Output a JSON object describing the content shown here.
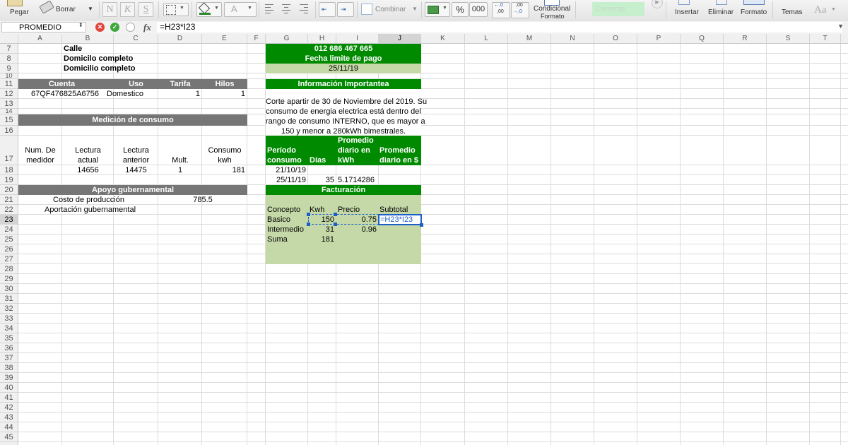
{
  "ribbon": {
    "paste_label": "Pegar",
    "clear_label": "Borrar",
    "bold": "N",
    "italic": "K",
    "underline": "S",
    "merge_label": "Combinar",
    "percent": "%",
    "thousands": "000",
    "inc_decimals_top": "←,0",
    "inc_decimals_bottom": ",00",
    "dec_decimals_top": ",00",
    "dec_decimals_bottom": "→,0",
    "conditional_label_1": "Condicional",
    "conditional_label_2": "Formato",
    "style_sample": "Correcto",
    "insert_label": "Insertar",
    "delete_label": "Eliminar",
    "format_label": "Formato",
    "themes_label": "Temas",
    "themes_font_sample": "Aa",
    "font_color_letter": "A",
    "style_correct_color": "#c6efce"
  },
  "formula_bar": {
    "name_box": "PROMEDIO",
    "fx_label": "fx",
    "cancel_glyph": "✕",
    "accept_glyph": "✓",
    "formula": "=H23*I23"
  },
  "grid": {
    "columns": [
      "A",
      "B",
      "C",
      "D",
      "E",
      "F",
      "G",
      "H",
      "I",
      "J",
      "K",
      "L",
      "M",
      "N",
      "O",
      "P",
      "Q",
      "R",
      "S",
      "T"
    ],
    "active_column": "J",
    "rows": [
      "7",
      "8",
      "9",
      "10",
      "11",
      "12",
      "13",
      "14",
      "15",
      "16",
      "17",
      "18",
      "19",
      "20",
      "21",
      "22",
      "23",
      "24",
      "25",
      "26",
      "27",
      "28",
      "29",
      "30",
      "31",
      "32",
      "33",
      "34",
      "35",
      "36",
      "37",
      "38",
      "39",
      "40",
      "41",
      "42",
      "43",
      "44",
      "45"
    ],
    "active_row": "23"
  },
  "colors": {
    "dark_header": "#767676",
    "green_header": "#008a00",
    "light_green": "#c5d9a8",
    "selection": "#1d5fc9"
  },
  "cells": {
    "b7": "Calle",
    "b8": "Domicilo completo",
    "b9": "Domicilio completo",
    "g7": "012 686 467 665",
    "g8": "Fecha limite de pago",
    "g9": "25/11/19",
    "a11": "Cuenta",
    "c11": "Uso",
    "d11": "Tarifa",
    "e11": "Hilos",
    "g11": "Información Importantea",
    "a12": "67QF476825A6756",
    "c12": "Domestico",
    "d12": "1",
    "e12": "1",
    "info_lines": [
      "Corte apartir de 30 de Noviembre del 2019. Su",
      "consumo de energia electrica está dentro del",
      "rango de consumo INTERNO, que es mayor a",
      "150 y menor a 280kWh bimestrales."
    ],
    "a15": "Medición de consumo",
    "g16_l1": "Promedio",
    "a17_l1": "Num. De",
    "a17_l2": "medidor",
    "b17_l1": "Lectura",
    "b17_l2": "actual",
    "c17_l1": "Lectura",
    "c17_l2": "anterior",
    "d17": "Mult.",
    "e17_l1": "Consumo",
    "e17_l2": "kwh",
    "g17_l1": "Período",
    "g17_l2": "consumo",
    "h17": "Días",
    "i17_l1": "diario en",
    "i17_l2": "kWh",
    "j17_l1": "Promedio",
    "j17_l2": "diario en $",
    "b18": "14656",
    "c18": "14475",
    "d18": "1",
    "e18": "181",
    "g18": "21/10/19",
    "g19": "25/11/19",
    "h19": "35",
    "i19": "5.1714286",
    "a20": "Apoyo gubernamental",
    "g20": "Facturación",
    "b21": "Costo de producción",
    "d21": "785.5",
    "b22": "Aportación gubernamental",
    "g22": "Concepto",
    "h22": "Kwh",
    "i22": "Precio",
    "j22": "Subtotal",
    "g23": "Basico",
    "h23": "150",
    "i23": "0.75",
    "j23": "=H23*I23",
    "g24": "Intermedio",
    "h24": "31",
    "i24": "0.96",
    "g25": "Suma",
    "h25": "181"
  }
}
